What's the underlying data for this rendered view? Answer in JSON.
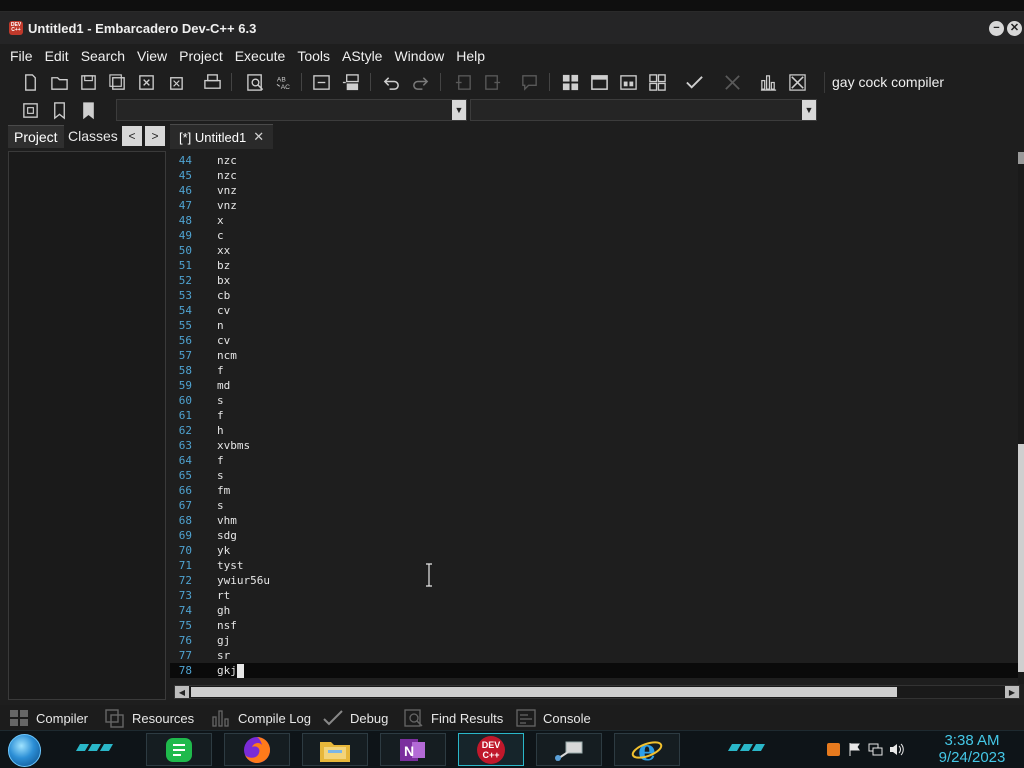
{
  "window": {
    "title": "Untitled1 - Embarcadero Dev-C++ 6.3",
    "app_icon_text": "DEV C++",
    "minimize": "−",
    "close": "✕"
  },
  "menu": [
    "File",
    "Edit",
    "Search",
    "View",
    "Project",
    "Execute",
    "Tools",
    "AStyle",
    "Window",
    "Help"
  ],
  "toolbar": {
    "compiler": "gay cock compiler"
  },
  "left_panel": {
    "tabs": [
      "Project",
      "Classes"
    ],
    "prev": "<",
    "next": ">"
  },
  "editor": {
    "tab_label": "[*] Untitled1",
    "tab_close": "✕",
    "lines": [
      {
        "n": "44",
        "t": "nzc"
      },
      {
        "n": "45",
        "t": "nzc"
      },
      {
        "n": "46",
        "t": "vnz"
      },
      {
        "n": "47",
        "t": "vnz"
      },
      {
        "n": "48",
        "t": "x"
      },
      {
        "n": "49",
        "t": "c"
      },
      {
        "n": "50",
        "t": "xx"
      },
      {
        "n": "51",
        "t": "bz"
      },
      {
        "n": "52",
        "t": "bx"
      },
      {
        "n": "53",
        "t": "cb"
      },
      {
        "n": "54",
        "t": "cv"
      },
      {
        "n": "55",
        "t": "n"
      },
      {
        "n": "56",
        "t": "cv"
      },
      {
        "n": "57",
        "t": "ncm"
      },
      {
        "n": "58",
        "t": "f"
      },
      {
        "n": "59",
        "t": "md"
      },
      {
        "n": "60",
        "t": "s"
      },
      {
        "n": "61",
        "t": "f"
      },
      {
        "n": "62",
        "t": "h"
      },
      {
        "n": "63",
        "t": "xvbms"
      },
      {
        "n": "64",
        "t": "f"
      },
      {
        "n": "65",
        "t": "s"
      },
      {
        "n": "66",
        "t": "fm"
      },
      {
        "n": "67",
        "t": "s"
      },
      {
        "n": "68",
        "t": "vhm"
      },
      {
        "n": "69",
        "t": "sdg"
      },
      {
        "n": "70",
        "t": "yk"
      },
      {
        "n": "71",
        "t": "tyst"
      },
      {
        "n": "72",
        "t": "ywiur56u"
      },
      {
        "n": "73",
        "t": "rt"
      },
      {
        "n": "74",
        "t": "gh"
      },
      {
        "n": "75",
        "t": "nsf"
      },
      {
        "n": "76",
        "t": "gj"
      },
      {
        "n": "77",
        "t": "sr"
      },
      {
        "n": "78",
        "t": "gkj"
      }
    ]
  },
  "bottom_tabs": [
    "Compiler",
    "Resources",
    "Compile Log",
    "Debug",
    "Find Results",
    "Console"
  ],
  "taskbar": {
    "apps": [
      "green-notes-icon",
      "firefox-icon",
      "file-explorer-icon",
      "onenote-icon",
      "devcpp-icon",
      "network-icon",
      "internet-explorer-icon"
    ],
    "devcpp_label": "DEV C++",
    "onenote_label": "N",
    "clock_time": "3:38 AM",
    "clock_date": "9/24/2023"
  },
  "colors": {
    "line_numbers": "#4fa3d1",
    "clock": "#44c7e6",
    "taskbar_accent": "#2ab7c9"
  }
}
